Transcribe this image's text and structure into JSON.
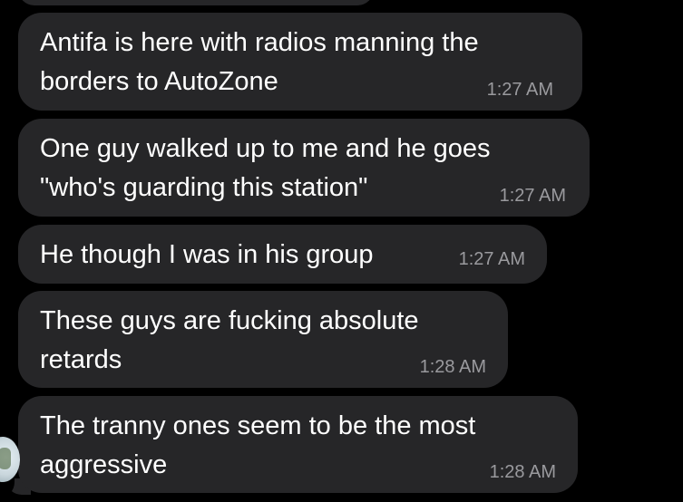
{
  "messages": [
    {
      "text": "Antifa is here with radios manning the\nborders to AutoZone",
      "time": "1:27 AM"
    },
    {
      "text": "One guy walked up to me and he goes\n\"who's guarding this station\"",
      "time": "1:27 AM"
    },
    {
      "text": "He though I was in his group",
      "time": "1:27 AM"
    },
    {
      "text": "These guys are fucking absolute\nretards",
      "time": "1:28 AM"
    },
    {
      "text": "The tranny ones seem to be the most\naggressive",
      "time": "1:28 AM"
    }
  ],
  "colors": {
    "background": "#000000",
    "bubble": "#262628",
    "message_text": "#ffffff",
    "timestamp": "#9a9a9e"
  }
}
